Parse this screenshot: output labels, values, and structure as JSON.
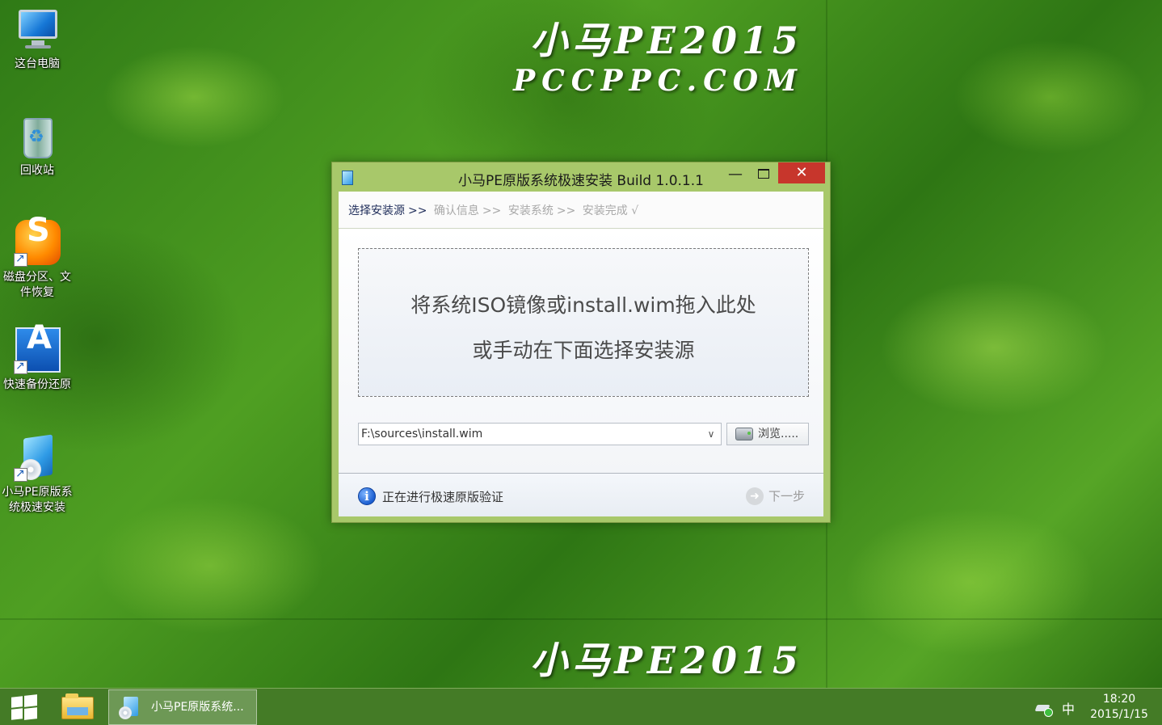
{
  "wallpaper": {
    "brand_line1": "小马PE2015",
    "brand_line2": "PCCPPC.COM"
  },
  "desktop_icons": [
    {
      "label": "这台电脑",
      "icon": "computer-icon"
    },
    {
      "label": "回收站",
      "icon": "recycle-bin-icon"
    },
    {
      "label": "磁盘分区、文件恢复",
      "icon": "disk-genius-icon"
    },
    {
      "label": "快速备份还原",
      "icon": "backup-restore-icon"
    },
    {
      "label": "小马PE原版系统极速安装",
      "icon": "installer-icon"
    }
  ],
  "dialog": {
    "title": "小马PE原版系统极速安装 Build 1.0.1.1",
    "close_glyph": "✕",
    "min_glyph": "—",
    "steps": {
      "active": "选择安装源",
      "separator": ">>",
      "items": [
        "确认信息",
        "安装系统",
        "安装完成 √"
      ]
    },
    "dropzone": {
      "line1": "将系统ISO镜像或install.wim拖入此处",
      "line2": "或手动在下面选择安装源"
    },
    "source_path": "F:\\sources\\install.wim",
    "browse_label": "浏览.....",
    "status_text": "正在进行极速原版验证",
    "next_label": "下一步",
    "colors": {
      "frame": "#a8c86a",
      "close": "#c7362c"
    }
  },
  "taskbar": {
    "running_task": "小马PE原版系统...",
    "ime": "中",
    "time": "18:20",
    "date": "2015/1/15"
  }
}
